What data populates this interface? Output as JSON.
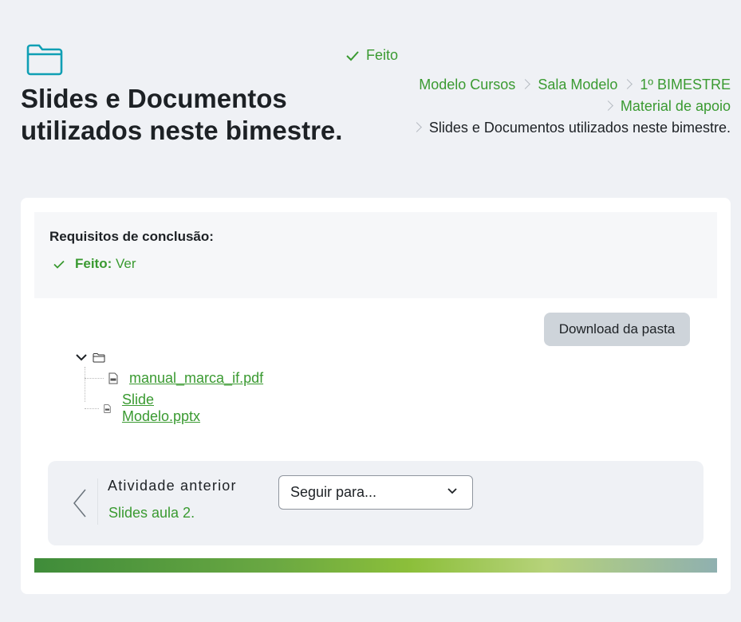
{
  "header": {
    "title": "Slides e Documentos utilizados neste bimestre.",
    "status": "Feito",
    "icon": "folder-icon"
  },
  "breadcrumb": [
    {
      "label": "Modelo Cursos"
    },
    {
      "label": "Sala Modelo"
    },
    {
      "label": "1º BIMESTRE"
    },
    {
      "label": "Material de apoio"
    },
    {
      "label": "Slides e Documentos utilizados neste bimestre."
    }
  ],
  "completion": {
    "title": "Requisitos de conclusão:",
    "item_status": "Feito:",
    "item_action": "Ver"
  },
  "download_label": "Download da pasta",
  "files": [
    {
      "name": "manual_marca_if.pdf",
      "icon": "pdf-file-icon"
    },
    {
      "name": "Slide Modelo.pptx",
      "icon": "pptx-file-icon"
    }
  ],
  "navigation": {
    "prev_label": "Atividade anterior",
    "prev_link": "Slides aula 2.",
    "jump_placeholder": "Seguir para..."
  },
  "colors": {
    "accent": "#3a9a31",
    "icon_teal": "#0f9fb4",
    "background": "#eff1f5"
  }
}
